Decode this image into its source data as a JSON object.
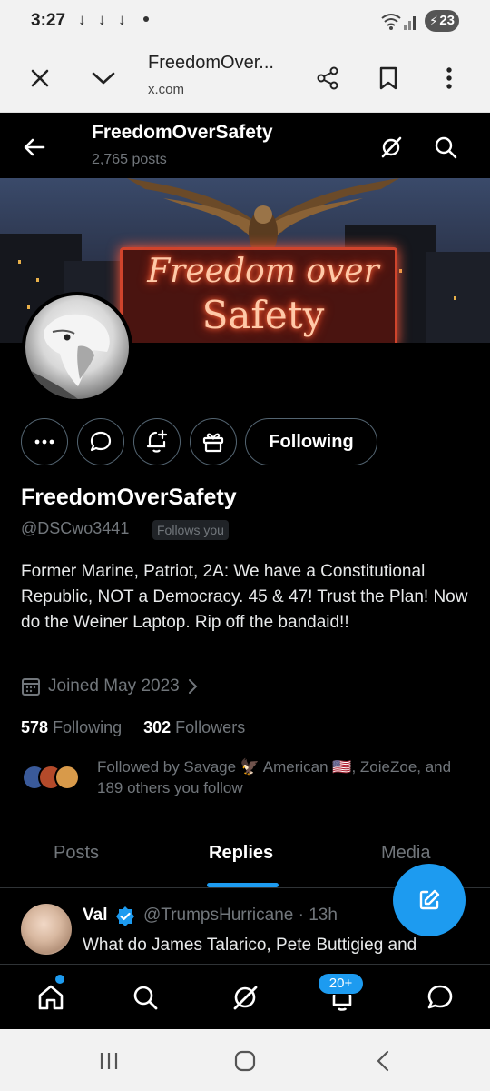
{
  "status_bar": {
    "time": "3:27",
    "download_icons": [
      "↓",
      "↓",
      "↓"
    ],
    "battery_level": "23"
  },
  "browser": {
    "page_title": "FreedomOver...",
    "domain": "x.com",
    "close_icon": "close-icon",
    "collapse_icon": "chevron-down-icon",
    "share_icon": "share-icon",
    "bookmark_icon": "bookmark-icon",
    "menu_icon": "more-vertical-icon"
  },
  "header": {
    "name": "FreedomOverSafety",
    "post_count": "2,765 posts"
  },
  "banner": {
    "line1": "Freedom over",
    "line2": "Safety"
  },
  "actions": {
    "following_label": "Following"
  },
  "profile": {
    "display_name": "FreedomOverSafety",
    "handle": "@DSCwo3441",
    "follows_you": "Follows you",
    "bio": "Former Marine, Patriot, 2A: We have a Constitutional Republic, NOT a Democracy. 45 & 47! Trust the Plan!  Now do the Weiner Laptop.  Rip off the bandaid!!",
    "joined": "Joined May 2023",
    "following_count": "578",
    "following_label": "Following",
    "followers_count": "302",
    "followers_label": "Followers",
    "followed_by": "Followed by Savage 🦅 American 🇺🇸, ZoieZoe, and 189 others you follow"
  },
  "tabs": [
    {
      "label": "Posts"
    },
    {
      "label": "Replies"
    },
    {
      "label": "Media"
    }
  ],
  "active_tab": "Replies",
  "tweet": {
    "name": "Val",
    "handle_time": "@TrumpsHurricane · 13h",
    "text": "What do James Talarico, Pete Buttigieg and"
  },
  "bottom_nav": {
    "notification_badge": "20+"
  },
  "colors": {
    "accent": "#1d9bf0",
    "background": "#000000",
    "text_primary": "#e7e9ea",
    "text_secondary": "#71767b",
    "border": "#536471"
  }
}
